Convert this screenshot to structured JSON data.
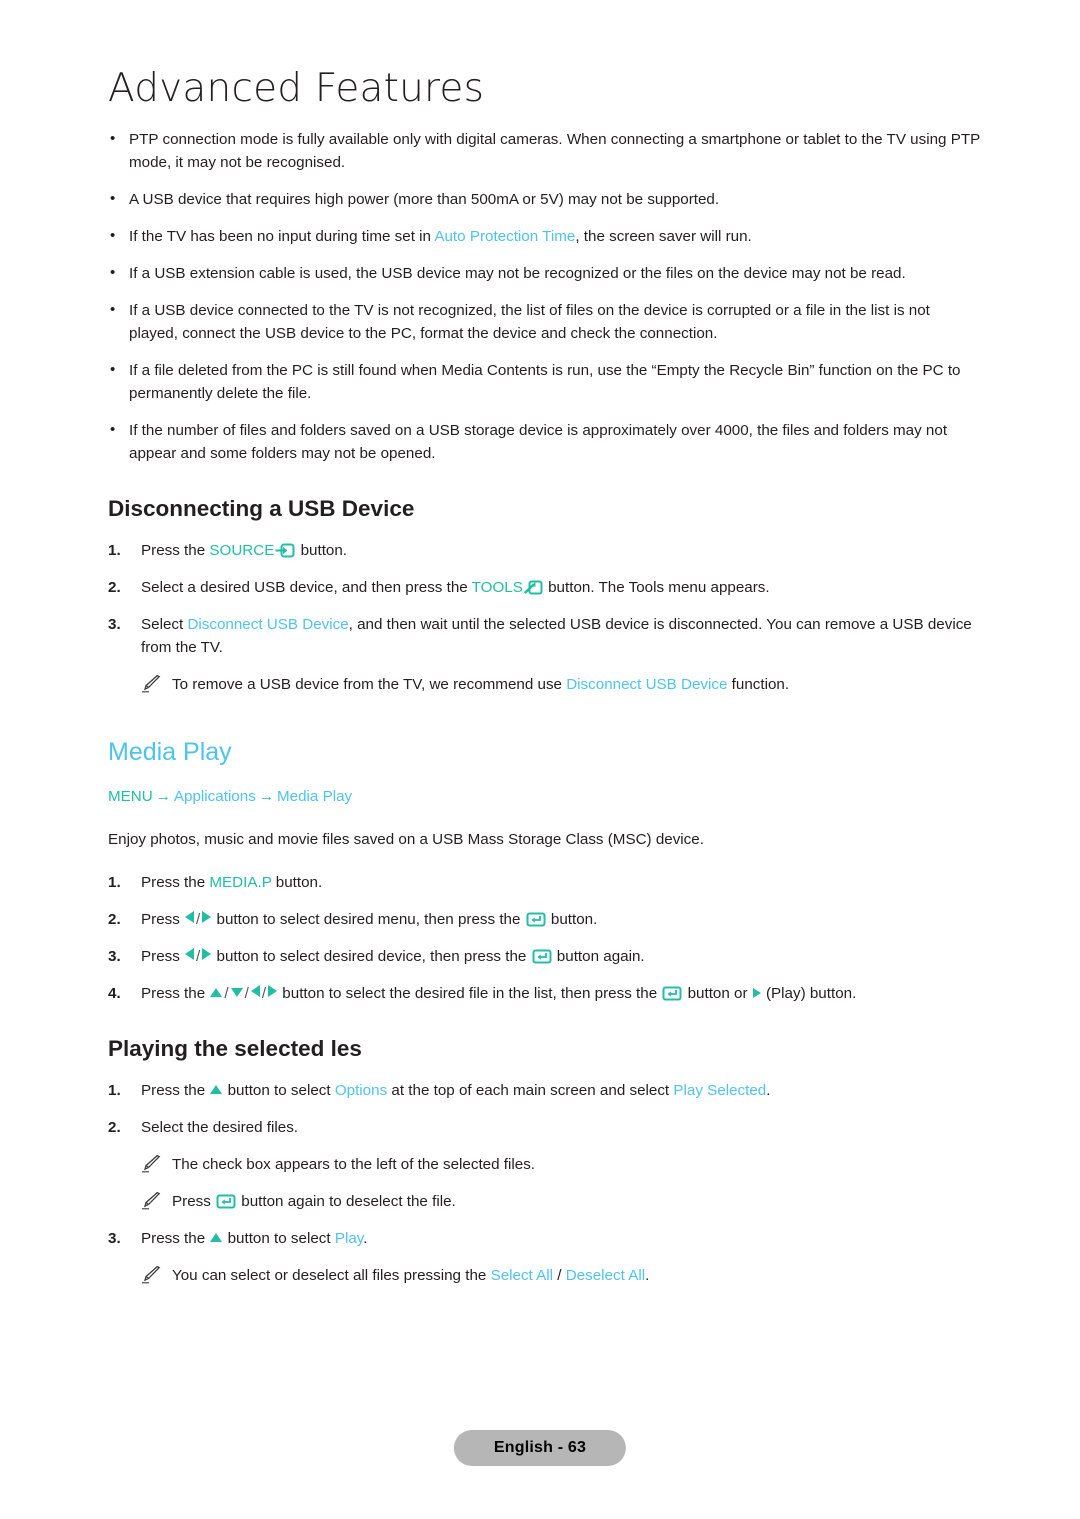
{
  "page": {
    "chapter_title": "Advanced Features",
    "footer_label": "English - 63"
  },
  "colors": {
    "blue": "#4ec3f0",
    "teal": "#23bda5",
    "text": "#231f20",
    "footer_pill_bg": "#b6b6b6"
  },
  "usb_notes": {
    "items": [
      "PTP connection mode is fully available only with digital cameras. When connecting a smartphone or tablet to the TV using PTP mode, it may not be recognised.",
      "A USB device that requires high power (more than 500mA or 5V) may not be supported.",
      "If a USB extension cable is used, the USB device may not be recognized or the files on the device may not be read.",
      "If a USB device connected to the TV is not recognized, the list of files on the device is corrupted or a file in the list is not played, connect the USB device to the PC, format the device and check the connection.",
      "If a file deleted from the PC is still found when Media Contents is run, use the “Empty the Recycle Bin” function on the PC to permanently delete the file.",
      "If the number of files and folders saved on a USB storage device is approximately over 4000, the files and folders may not appear and some folders may not be opened."
    ],
    "screensaver_pre": "If the TV has been no input during time set in ",
    "screensaver_link": "Auto Protection Time",
    "screensaver_post": ", the screen saver will run."
  },
  "disconnect_section": {
    "title": "Disconnecting a USB Device",
    "step1": {
      "num": "1.",
      "pre": "Press the ",
      "link": "SOURCE",
      "icon": "source-icon",
      "post": " button."
    },
    "step2": {
      "num": "2.",
      "pre": "Select a desired USB device, and then press the ",
      "link": "TOOLS",
      "icon": "tools-icon",
      "post": " button. The Tools menu appears."
    },
    "step3": {
      "num": "3.",
      "pre": "Select ",
      "link": "Disconnect USB Device",
      "post": ", and then wait until the selected USB device is disconnected. You can remove a USB device from the TV."
    },
    "note": {
      "pre": "To remove a USB device from the TV, we recommend use ",
      "link": "Disconnect USB Device",
      "post": " function."
    }
  },
  "media_play": {
    "title": "Media Play",
    "breadcrumb": {
      "menu": "MENU",
      "arrow": "→",
      "item1": "Applications",
      "item2": "Media Play"
    },
    "intro": "Enjoy photos, music and movie files saved on a USB Mass Storage Class (MSC) device.",
    "step1": {
      "num": "1.",
      "pre": "Press the ",
      "link": "MEDIA.P",
      "post": " button."
    },
    "step2": {
      "num": "2.",
      "pre": "Press ",
      "mid": " button to select desired menu, then press the ",
      "post": " button."
    },
    "step3": {
      "num": "3.",
      "pre": "Press ",
      "mid": " button to select desired device, then press the ",
      "post": " button again."
    },
    "step4": {
      "num": "4.",
      "pre": "Press the ",
      "mid": " button to select the desired file in the list, then press the ",
      "mid2": " button or ",
      "post": " (Play) button."
    }
  },
  "playing_selected": {
    "title": "Playing the selected  les",
    "step1": {
      "num": "1.",
      "pre": "Press the ",
      "mid": " button to select ",
      "link1": "Options",
      "mid2": " at the top of each main screen and select ",
      "link2": "Play Selected",
      "post": "."
    },
    "step2": {
      "num": "2.",
      "text": "Select the desired files."
    },
    "note1": "The check box appears to the left of the selected files.",
    "note2": {
      "pre": "Press ",
      "post": " button again to deselect the file."
    },
    "step3": {
      "num": "3.",
      "pre": "Press the ",
      "mid": " button to select ",
      "link": "Play",
      "post": "."
    },
    "note3": {
      "pre": "You can select or deselect all files pressing the ",
      "link1": "Select All",
      "sep": " / ",
      "link2": "Deselect All",
      "post": "."
    }
  }
}
